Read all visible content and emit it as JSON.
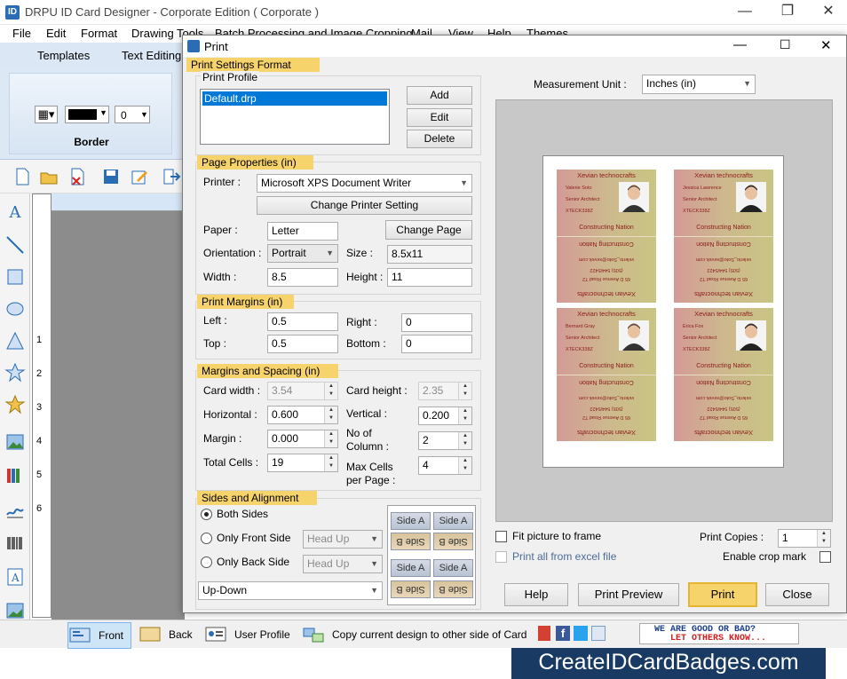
{
  "app": {
    "title": "DRPU ID Card Designer - Corporate Edition ( Corporate )",
    "menu": [
      "File",
      "Edit",
      "Format",
      "Drawing Tools",
      "Batch Processing and Image Cropping",
      "Mail",
      "View",
      "Help",
      "Themes"
    ],
    "ribbon_tabs": [
      "Templates",
      "Text Editing"
    ],
    "border_group": {
      "label": "Border",
      "color_value": "",
      "width_value": "0"
    },
    "ruler_numbers": [
      "1",
      "2",
      "3",
      "4",
      "5",
      "6"
    ]
  },
  "statusbar": {
    "buttons": [
      "Front",
      "Back",
      "User Profile",
      "Copy current design to other side of Card"
    ],
    "promo_line1": "WE ARE GOOD OR BAD?",
    "promo_line2": "LET OTHERS KNOW..."
  },
  "banner": "CreateIDCardBadges.com",
  "dialog": {
    "title": "Print",
    "print_settings_format": "Print Settings Format",
    "print_profile": {
      "label": "Print Profile",
      "items": [
        "Default.drp"
      ],
      "selected": "Default.drp",
      "add": "Add",
      "edit": "Edit",
      "delete": "Delete"
    },
    "page_properties": {
      "heading": "Page Properties  (in)",
      "printer_label": "Printer :",
      "printer_value": "Microsoft XPS Document Writer",
      "change_printer": "Change Printer Setting",
      "paper_label": "Paper :",
      "paper_value": "Letter",
      "change_page": "Change Page",
      "orientation_label": "Orientation :",
      "orientation_value": "Portrait",
      "size_label": "Size :",
      "size_value": "8.5x11",
      "width_label": "Width :",
      "width_value": "8.5",
      "height_label": "Height :",
      "height_value": "11"
    },
    "print_margins": {
      "heading": "Print Margins (in)",
      "left_label": "Left :",
      "left_value": "0.5",
      "right_label": "Right :",
      "right_value": "0",
      "top_label": "Top :",
      "top_value": "0.5",
      "bottom_label": "Bottom :",
      "bottom_value": "0"
    },
    "margins_spacing": {
      "heading": "Margins and Spacing  (in)",
      "card_width_label": "Card width :",
      "card_width_value": "3.54",
      "card_height_label": "Card height :",
      "card_height_value": "2.35",
      "horizontal_label": "Horizontal :",
      "horizontal_value": "0.600",
      "vertical_label": "Vertical :",
      "vertical_value": "0.200",
      "margin_label": "Margin :",
      "margin_value": "0.000",
      "columns_label_1": "No of",
      "columns_label_2": "Column :",
      "columns_value": "2",
      "total_cells_label": "Total Cells :",
      "total_cells_value": "19",
      "max_cells_label_1": "Max Cells",
      "max_cells_label_2": "per Page :",
      "max_cells_value": "4"
    },
    "sides_alignment": {
      "heading": "Sides and Alignment",
      "both_sides": "Both Sides",
      "only_front": "Only Front Side",
      "only_back": "Only Back Side",
      "head_up": "Head Up",
      "selected": "Both Sides",
      "order": "Up-Down",
      "side_a": "Side A",
      "side_b": "Side B"
    },
    "measurement_label": "Measurement Unit :",
    "measurement_value": "Inches (in)",
    "fit_picture": "Fit picture to frame",
    "print_all_excel": "Print all from excel file",
    "print_copies_label": "Print Copies :",
    "print_copies_value": "1",
    "enable_crop_mark": "Enable crop mark",
    "buttons": {
      "help": "Help",
      "preview": "Print Preview",
      "print": "Print",
      "close": "Close"
    }
  },
  "cards": [
    {
      "company": "Xevian technocrafts",
      "name": "Valerie Soto",
      "title": "Senior Architect",
      "id": "XTECK338Z",
      "footer": "Constructing Nation",
      "back_line1": "velerio_Soto@xevek.com",
      "back_line2": "(505) 544/5422",
      "back_line3": "65 D Avenue Road T2",
      "photo": "man"
    },
    {
      "company": "Xevian technocrafts",
      "name": "Jessica Lawrence",
      "title": "Senior Architect",
      "id": "XTECK338Z",
      "footer": "Constructing Nation",
      "back_line1": "velerio_Soto@xevek.com",
      "back_line2": "(505) 544/5422",
      "back_line3": "65 D Avenue Road T2",
      "photo": "woman"
    },
    {
      "company": "Xevian technocrafts",
      "name": "Bernard Gray",
      "title": "Senior Architect",
      "id": "XTECK338Z",
      "footer": "Constructing Nation",
      "back_line1": "velerio_Soto@xevek.com",
      "back_line2": "(505) 544/5422",
      "back_line3": "65 D Avenue Road T2",
      "photo": "man"
    },
    {
      "company": "Xevian technocrafts",
      "name": "Erica Fox",
      "title": "Senior Architect",
      "id": "XTECK338Z",
      "footer": "Constructing Nation",
      "back_line1": "velerio_Soto@xevek.com",
      "back_line2": "(505) 544/5422",
      "back_line3": "65 D Avenue Road T2",
      "photo": "woman"
    }
  ],
  "back_header": "Xevian technocrafts"
}
